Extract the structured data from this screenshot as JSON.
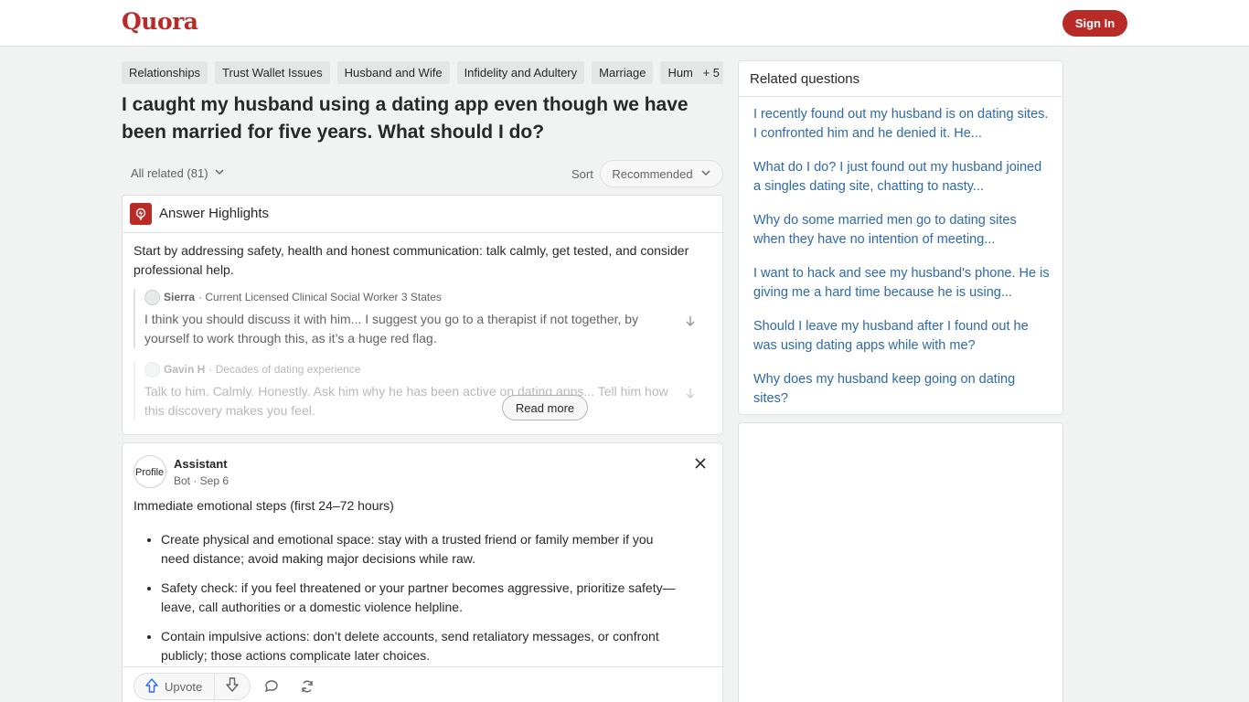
{
  "header": {
    "logo": "Quora",
    "sign_in": "Sign In"
  },
  "topics": {
    "items": [
      "Relationships",
      "Trust Wallet Issues",
      "Husband and Wife",
      "Infidelity and Adultery",
      "Marriage",
      "Hum"
    ],
    "more": "+ 5"
  },
  "question": {
    "title": "I caught my husband using a dating app even though we have been married for five years. What should I do?"
  },
  "filters": {
    "all_related": "All related (81)",
    "sort_label": "Sort",
    "sort_value": "Recommended"
  },
  "highlights": {
    "title": "Answer Highlights",
    "summary": "Start by addressing safety, health and honest communication: talk calmly, get tested, and consider professional help.",
    "sources": [
      {
        "name": "Sierra",
        "credential": "· Current Licensed Clinical Social Worker 3 States",
        "text": "I think you should discuss it with him... I suggest you go to a therapist if not together, by yourself to work through this, as it’s a huge red flag."
      },
      {
        "name": "Gavin H",
        "credential": "· Decades of dating experience",
        "text": "Talk to him. Calmly. Honestly. Ask him why he has been active on dating apps... Tell him how this discovery makes you feel."
      }
    ],
    "read_more": "Read more"
  },
  "assistant": {
    "avatar_alt": "Profile",
    "name": "Assistant",
    "meta": "Bot · Sep 6",
    "intro": "Immediate emotional steps (first 24–72 hours)",
    "bullets": [
      "Create physical and emotional space: stay with a trusted friend or family member if you need distance; avoid making major decisions while raw.",
      "Safety check: if you feel threatened or your partner becomes aggressive, prioritize safety—leave, call authorities or a domestic violence helpline.",
      "Contain impulsive actions: don’t delete accounts, send retaliatory messages, or confront publicly; those actions complicate later choices."
    ],
    "upvote": "Upvote"
  },
  "related": {
    "title": "Related questions",
    "items": [
      "I recently found out my husband is on dating sites. I confronted him and he denied it. He...",
      "What do I do? I just found out my husband joined a singles dating site, chatting to nasty...",
      "Why do some married men go to dating sites when they have no intention of meeting...",
      "I want to hack and see my husband's phone. He is giving me a hard time because he is using...",
      "Should I leave my husband after I found out he was using dating apps while with me?",
      "Why does my husband keep going on dating sites?"
    ]
  },
  "colors": {
    "brand": "#b92b27",
    "link": "#2e69a8",
    "background": "#f1f2f2"
  }
}
